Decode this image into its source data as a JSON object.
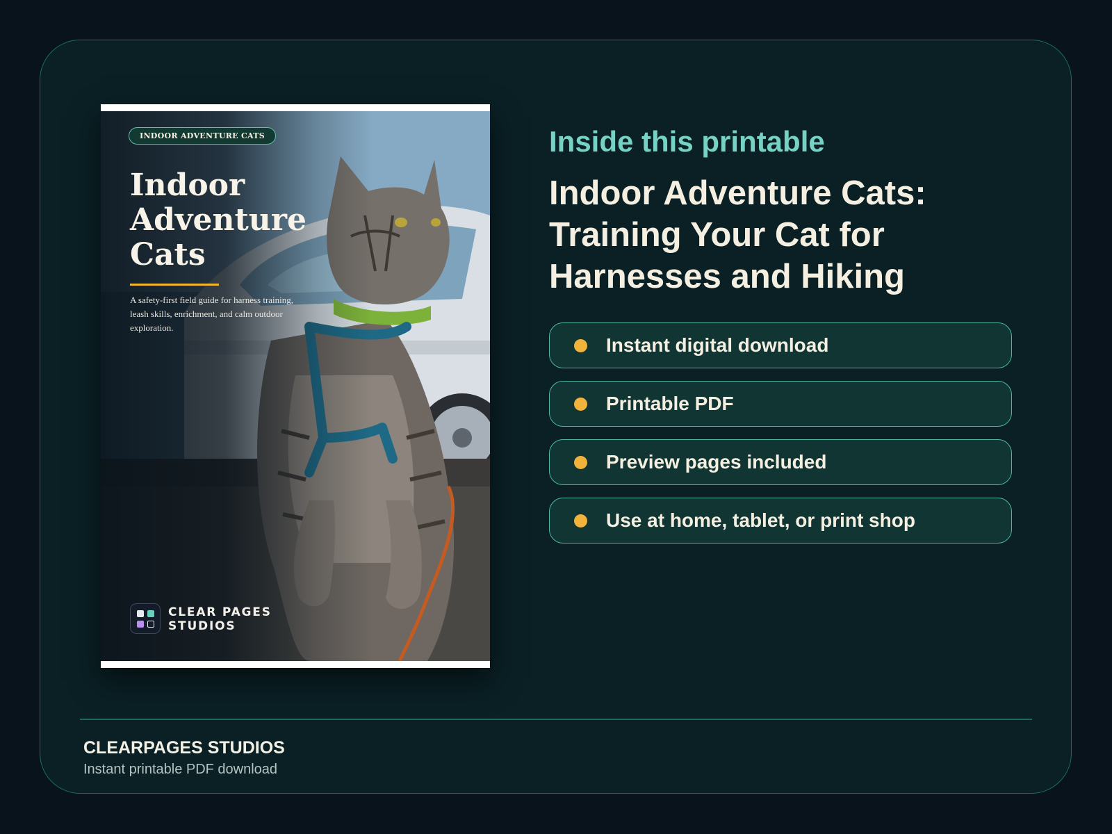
{
  "cover": {
    "badge": "INDOOR ADVENTURE CATS",
    "title": "Indoor Adventure Cats",
    "subtitle": "A safety-first field guide for harness training, leash skills, enrichment, and calm outdoor exploration.",
    "publisher": "CLEAR PAGES STUDIOS",
    "image": "photo-of-tabby-cat-standing-in-teal-harness-beside-white-car"
  },
  "details": {
    "eyebrow": "Inside this printable",
    "title": "Indoor Adventure Cats: Training Your Cat for Harnesses and Hiking",
    "features": [
      {
        "label": "Instant digital download"
      },
      {
        "label": "Printable PDF"
      },
      {
        "label": "Preview pages included"
      },
      {
        "label": "Use at home, tablet, or print shop"
      }
    ]
  },
  "footer": {
    "brand": "CLEARPAGES STUDIOS",
    "tagline": "Instant printable PDF download"
  },
  "colors": {
    "background": "#08131b",
    "card": "#0a2025",
    "accent_teal": "#76d2c4",
    "bullet": "#f2b33d",
    "cover_rule": "#f2b531",
    "text_cream": "#f4efe1"
  },
  "icons": {
    "bullet": "bullet-dot-icon",
    "logo": "clear-pages-logo-icon"
  }
}
